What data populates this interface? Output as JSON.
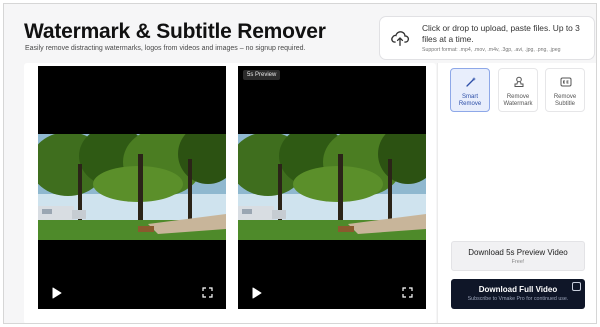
{
  "header": {
    "title": "Watermark & Subtitle Remover",
    "subtitle": "Easily remove distracting watermarks, logos from videos and images – no signup required."
  },
  "upload": {
    "main_text": "Click or drop to upload, paste files. Up to 3 files at a time.",
    "formats": "Support format: .mp4, .mov, .m4v, .3gp, .avi, .jpg, .png, .jpeg",
    "icon": "cloud-upload-icon"
  },
  "preview": {
    "badge": "5s Preview",
    "left_icons": [
      "play-icon",
      "fullscreen-icon"
    ],
    "right_icons": [
      "play-icon",
      "fullscreen-icon"
    ]
  },
  "tools": [
    {
      "line1": "Smart",
      "line2": "Remove",
      "icon": "magic-wand-icon",
      "active": true
    },
    {
      "line1": "Remove",
      "line2": "Watermark",
      "icon": "stamp-icon",
      "active": false
    },
    {
      "line1": "Remove",
      "line2": "Subtitle",
      "icon": "cc-icon",
      "active": false
    }
  ],
  "downloads": {
    "preview_label": "Download 5s Preview Video",
    "preview_sub": "Free!",
    "full_label": "Download Full Video",
    "full_sub": "Subscribe to Vmake Pro for continued use."
  },
  "colors": {
    "accent": "#2d4fa8",
    "dark_button": "#0f1628",
    "panel_bg": "#000000"
  }
}
